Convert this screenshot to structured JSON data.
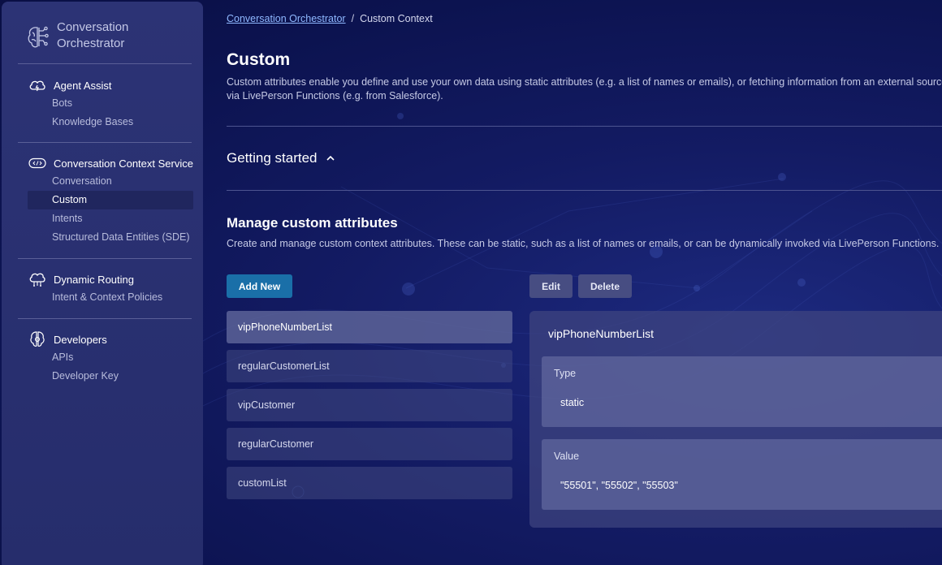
{
  "sidebar": {
    "brand": "Conversation Orchestrator",
    "sections": [
      {
        "title": "Agent Assist",
        "icon": "cloud-icon",
        "items": [
          {
            "label": "Bots"
          },
          {
            "label": "Knowledge Bases"
          }
        ]
      },
      {
        "title": "Conversation Context Service",
        "icon": "code-icon",
        "items": [
          {
            "label": "Conversation"
          },
          {
            "label": "Custom",
            "active": true
          },
          {
            "label": "Intents"
          },
          {
            "label": "Structured Data Entities (SDE)"
          }
        ]
      },
      {
        "title": "Dynamic Routing",
        "icon": "routing-cloud-icon",
        "items": [
          {
            "label": "Intent & Context Policies"
          }
        ]
      },
      {
        "title": "Developers",
        "icon": "developer-icon",
        "items": [
          {
            "label": "APIs"
          },
          {
            "label": "Developer Key"
          }
        ]
      }
    ]
  },
  "breadcrumb": {
    "root": "Conversation Orchestrator",
    "separator": "/",
    "current": "Custom Context"
  },
  "page": {
    "title": "Custom",
    "description": "Custom attributes enable you define and use your own data using static attributes (e.g. a list of names or emails), or fetching information from an external source via LivePerson Functions (e.g. from Salesforce)."
  },
  "getting_started": {
    "label": "Getting started",
    "expanded": true
  },
  "manage": {
    "title": "Manage custom attributes",
    "description": "Create and manage custom context attributes. These can be static, such as a list of names or emails, or can be dynamically invoked via LivePerson Functions.",
    "add_label": "Add New",
    "edit_label": "Edit",
    "delete_label": "Delete",
    "attributes": [
      {
        "name": "vipPhoneNumberList",
        "selected": true
      },
      {
        "name": "regularCustomerList"
      },
      {
        "name": "vipCustomer"
      },
      {
        "name": "regularCustomer"
      },
      {
        "name": "customList"
      }
    ]
  },
  "detail": {
    "title": "vipPhoneNumberList",
    "type_label": "Type",
    "type_value": "static",
    "value_label": "Value",
    "value_value": "\"55501\", \"55502\", \"55503\""
  },
  "colors": {
    "accent": "#1a6fa8",
    "link": "#8fb8ff",
    "sidebar": "#2c3375"
  }
}
